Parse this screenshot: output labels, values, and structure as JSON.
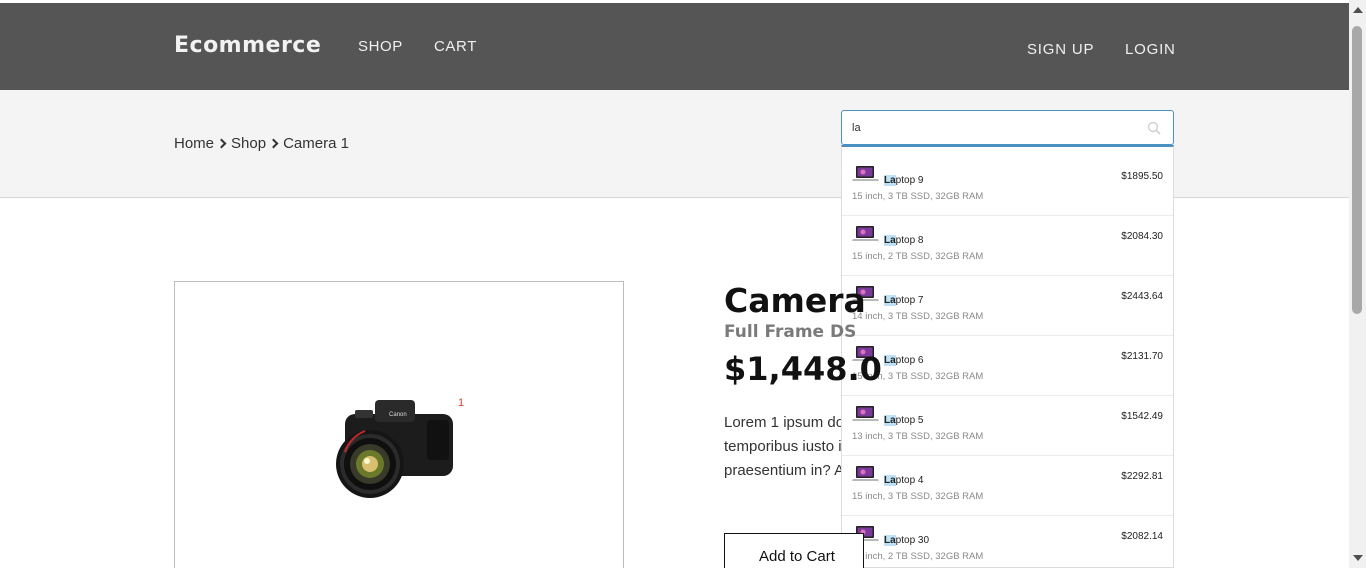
{
  "navbar": {
    "brand": "Ecommerce",
    "links": [
      "SHOP",
      "CART"
    ],
    "right_links": [
      "SIGN UP",
      "LOGIN"
    ],
    "bg_color": "#555555"
  },
  "breadcrumb": {
    "items": [
      "Home",
      "Shop",
      "Camera 1"
    ]
  },
  "search": {
    "value": "la",
    "icon": "search-icon",
    "accent": "#4a90c2"
  },
  "suggestions": [
    {
      "highlight": "La",
      "rest": "ptop 9",
      "spec": "15 inch, 3 TB SSD, 32GB RAM",
      "price": "$1895.50",
      "icon": "laptop-icon"
    },
    {
      "highlight": "La",
      "rest": "ptop 8",
      "spec": "15 inch, 2 TB SSD, 32GB RAM",
      "price": "$2084.30",
      "icon": "laptop-icon"
    },
    {
      "highlight": "La",
      "rest": "ptop 7",
      "spec": "14 inch, 3 TB SSD, 32GB RAM",
      "price": "$2443.64",
      "icon": "laptop-icon"
    },
    {
      "highlight": "La",
      "rest": "ptop 6",
      "spec": "15 inch, 3 TB SSD, 32GB RAM",
      "price": "$2131.70",
      "icon": "laptop-icon"
    },
    {
      "highlight": "La",
      "rest": "ptop 5",
      "spec": "13 inch, 3 TB SSD, 32GB RAM",
      "price": "$1542.49",
      "icon": "laptop-icon"
    },
    {
      "highlight": "La",
      "rest": "ptop 4",
      "spec": "15 inch, 3 TB SSD, 32GB RAM",
      "price": "$2292.81",
      "icon": "laptop-icon"
    },
    {
      "highlight": "La",
      "rest": "ptop 30",
      "spec": "15 inch, 2 TB SSD, 32GB RAM",
      "price": "$2082.14",
      "icon": "laptop-icon"
    }
  ],
  "product": {
    "title": "Camera",
    "subtitle": "Full Frame DS",
    "price": "$1,448.0",
    "description_lines": [
      "Lorem 1 ipsum do",
      "temporibus iusto i",
      "praesentium in? A"
    ],
    "image_badge": "1",
    "image": "camera-icon",
    "add_to_cart": "Add to Cart"
  }
}
